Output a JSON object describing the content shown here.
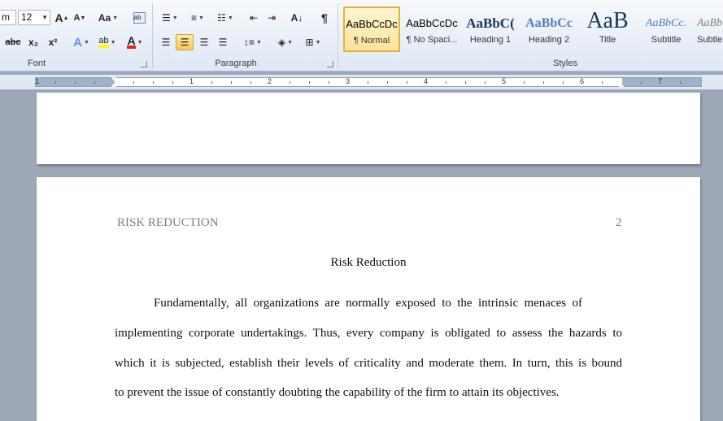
{
  "ribbon": {
    "font_group": {
      "label": "Font",
      "font_name": "m",
      "font_size": "12",
      "grow_label": "A",
      "shrink_label": "A",
      "change_case_label": "Aa",
      "strike_label": "abc",
      "subscript_label": "x₂",
      "superscript_label": "x²",
      "text_effects_label": "A",
      "highlight_label": "ab",
      "font_color_label": "A"
    },
    "paragraph_group": {
      "label": "Paragraph",
      "show_marks_label": "¶"
    },
    "styles_group": {
      "label": "Styles",
      "items": [
        {
          "sample": "AaBbCcDc",
          "name": "¶ Normal"
        },
        {
          "sample": "AaBbCcDc",
          "name": "¶ No Spaci..."
        },
        {
          "sample": "AaBbC(",
          "name": "Heading 1"
        },
        {
          "sample": "AaBbCc",
          "name": "Heading 2"
        },
        {
          "sample": "AaB",
          "name": "Title"
        },
        {
          "sample": "AaBbCc.",
          "name": "Subtitle"
        },
        {
          "sample": "AaBb",
          "name": "Subtle"
        }
      ]
    }
  },
  "ruler": {
    "numbers": [
      "1",
      "1",
      "2",
      "3",
      "4",
      "5",
      "6",
      "7"
    ]
  },
  "document": {
    "header_title": "RISK REDUCTION",
    "page_number": "2",
    "title": "Risk Reduction",
    "lines": [
      "Fundamentally, all organizations are normally exposed to the intrinsic menaces of",
      "implementing corporate undertakings. Thus, every company is obligated to assess the hazards to",
      "which it is subjected, establish their levels of criticality and moderate them. In turn, this is bound",
      "to prevent the issue of constantly doubting the capability of the firm to attain its objectives."
    ]
  },
  "colors": {
    "selected_style": "#fde39a",
    "heading_blue": "#17365d",
    "header_grey": "#7f7f7f"
  }
}
